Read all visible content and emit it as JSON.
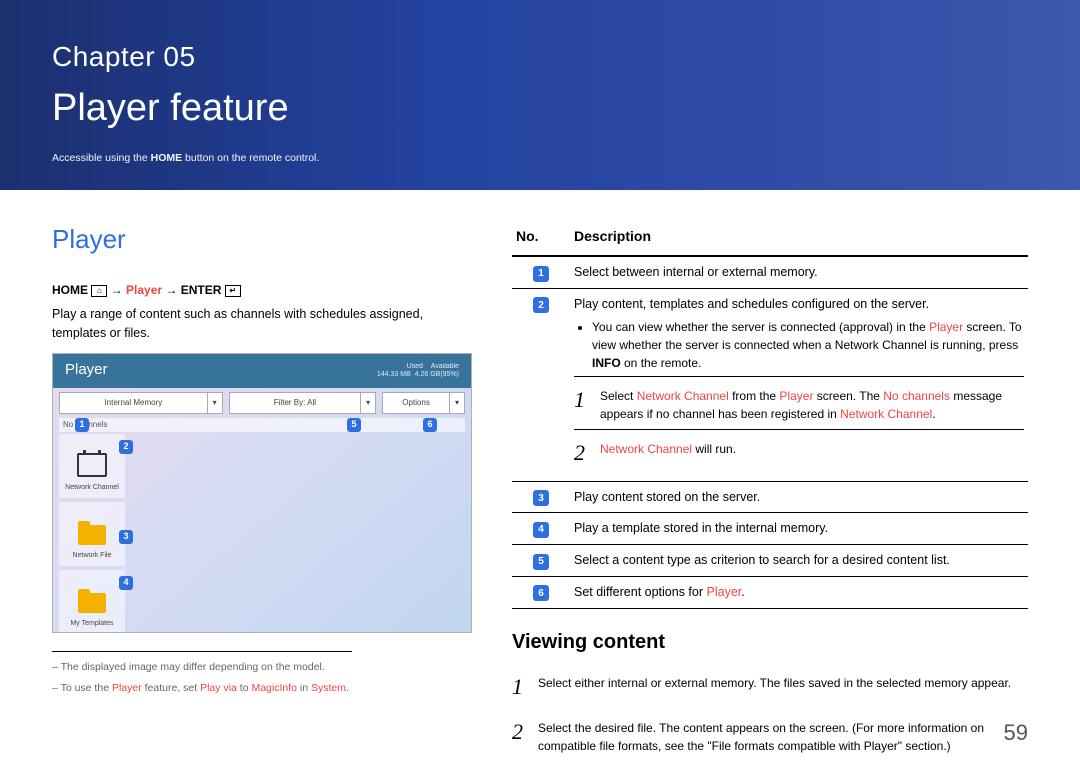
{
  "hero": {
    "chapter": "Chapter 05",
    "title": "Player feature",
    "subtitle_pre": "Accessible using the ",
    "subtitle_bold": "HOME",
    "subtitle_post": " button on the remote control."
  },
  "left": {
    "heading": "Player",
    "path_home": "HOME ",
    "path_arrow": " → ",
    "path_player": "Player",
    "path_enter": " ENTER ",
    "intro": "Play a range of content such as channels with schedules assigned, templates or files.",
    "screenshot": {
      "title": "Player",
      "usedline": "Used",
      "used": "144.33 MB",
      "availline": "Available",
      "avail": "4.26 GB(95%)",
      "tab_internal": "Internal Memory",
      "tab_filter": "Filter By: All",
      "tab_options": "Options",
      "banner": "No channels",
      "tile1": "Network Channel",
      "tile2": "Network File",
      "tile3": "My Templates"
    },
    "footnotes": [
      {
        "pre": "The displayed image may differ depending on the model.",
        "spans": []
      },
      {
        "pre": "To use the ",
        "s1": "Player",
        "mid": " feature, set ",
        "s2": "Play via",
        "mid2": " to ",
        "s3": "MagicInfo",
        "mid3": " in ",
        "s4": "System",
        "post": "."
      }
    ]
  },
  "table": {
    "col_no": "No.",
    "col_desc": "Description",
    "rows": [
      {
        "num": "1",
        "desc": "Select between internal or external memory."
      },
      {
        "num": "2",
        "desc": "Play content, templates and schedules configured on the server.",
        "bullets": [
          "You can view whether the server is connected (approval) in the Player screen. To view whether the server is connected when a Network Channel is running, press INFO on the remote."
        ],
        "steps": [
          {
            "n": "1",
            "pre": "Select ",
            "hl1": "Network Channel",
            "mid": " from the ",
            "hl2": "Player",
            "mid2": " screen. The ",
            "hl3": "No channels",
            "post": " message appears if no channel has been registered in ",
            "hl4": "Network Channel",
            "end": "."
          },
          {
            "n": "2",
            "pre": "",
            "hl1": "Network Channel",
            "mid": " will run.",
            "hl2": "",
            "mid2": "",
            "hl3": "",
            "post": "",
            "hl4": "",
            "end": ""
          }
        ]
      },
      {
        "num": "3",
        "desc": "Play content stored on the server."
      },
      {
        "num": "4",
        "desc": "Play a template stored in the internal memory."
      },
      {
        "num": "5",
        "desc": "Select a content type as criterion to search for a desired content list."
      },
      {
        "num": "6",
        "desc_pre": "Set different options for ",
        "desc_hl": "Player",
        "desc_post": "."
      }
    ]
  },
  "viewing": {
    "heading": "Viewing content",
    "steps": [
      {
        "n": "1",
        "text": "Select either internal or external memory. The files saved in the selected memory appear."
      },
      {
        "n": "2",
        "text": "Select the desired file. The content appears on the screen. (For more information on compatible file formats, see the \"File formats compatible with Player\" section.)"
      }
    ]
  },
  "page_number": "59"
}
